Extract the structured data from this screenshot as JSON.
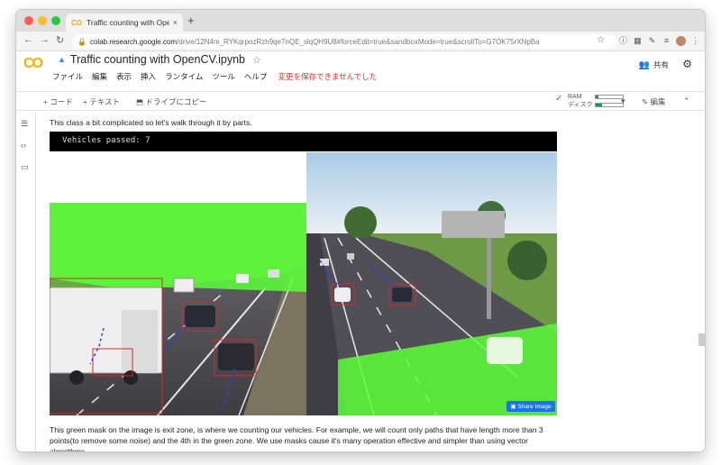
{
  "browser": {
    "tab_title": "Traffic counting with OpenCV.ipy",
    "tab_favicon": "CO",
    "tab_close": "×",
    "new_tab": "+",
    "url_host": "colab.research.google.com",
    "url_path": "/drive/12N4m_RYKqrpozRzh9qe7nQE_slqQH9U8#forceEdit=true&sandboxMode=true&scrollTo=G7OK75rXNpBa"
  },
  "colab": {
    "logo": "CO",
    "notebook_title": "Traffic counting with OpenCV.ipynb",
    "menu": [
      "ファイル",
      "編集",
      "表示",
      "挿入",
      "ランタイム",
      "ツール",
      "ヘルプ"
    ],
    "unsaved": "変更を保存できませんでした",
    "share_label": "共有"
  },
  "toolbar": {
    "add_code": "+ コード",
    "add_text": "+ テキスト",
    "copy_drive": "ドライブにコピー",
    "ram_label": "RAM",
    "disk_label": "ディスク",
    "edit_label": "編集",
    "ram_usage": 0.1,
    "disk_usage": 0.24
  },
  "notebook": {
    "intro_text": "This class a bit complicated so let's walk through it by parts.",
    "output_text": "Vehicles passed: 7",
    "share_image_label": "Share Image",
    "description": "This green mask on the image is exit zone, is where we counting our vehicles. For example, we will count only paths that have length more than 3 points(to remove some noise) and the 4th in the green zone. We use masks cause it's many operation effective and simpler than using vector algorithms."
  },
  "colors": {
    "accent": "#f9ab00",
    "mask_green": "#5cff3a",
    "box_red": "#d22a2a",
    "link_blue": "#1a73e8"
  }
}
